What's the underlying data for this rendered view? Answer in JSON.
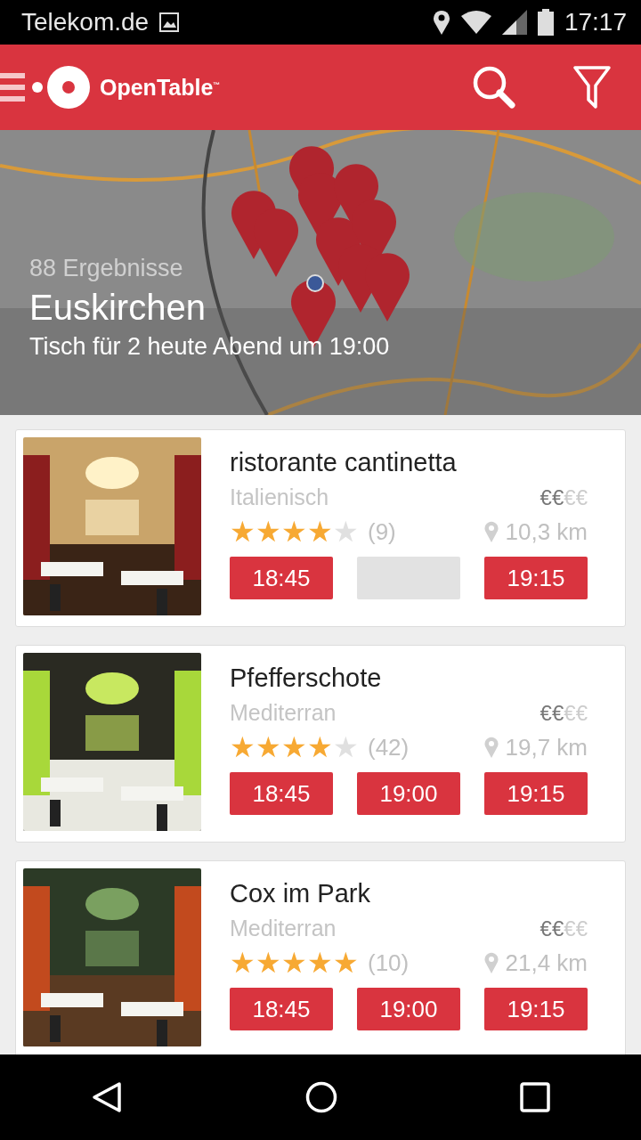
{
  "status_bar": {
    "carrier": "Telekom.de",
    "time": "17:17"
  },
  "app_bar": {
    "logo": "OpenTable$^{™}$"
  },
  "map": {
    "results": "88 Ergebnisse",
    "location": "Euskirchen",
    "query": "Tisch für 2 heute Abend um 19:00"
  },
  "restaurants": [
    {
      "name": "ristorante cantinetta",
      "cuisine": "Italienisch",
      "price": {
        "active": "€€",
        "inactive": "€€"
      },
      "stars": 4,
      "reviews": "(9)",
      "distance": "10,3 km",
      "slots": [
        {
          "time": "18:45",
          "available": true
        },
        {
          "available": false
        },
        {
          "time": "19:15",
          "available": true
        }
      ]
    },
    {
      "name": "Pfefferschote",
      "cuisine": "Mediterran",
      "price": {
        "active": "€€",
        "inactive": "€€"
      },
      "stars": 4,
      "reviews": "(42)",
      "distance": "19,7 km",
      "slots": [
        {
          "time": "18:45",
          "available": true
        },
        {
          "time": "19:00",
          "available": true
        },
        {
          "time": "19:15",
          "available": true
        }
      ]
    },
    {
      "name": "Cox im Park",
      "cuisine": "Mediterran",
      "price": {
        "active": "€€",
        "inactive": "€€"
      },
      "stars": 5,
      "reviews": "(10)",
      "distance": "21,4 km",
      "slots": [
        {
          "time": "18:45",
          "available": true
        },
        {
          "time": "19:00",
          "available": true
        },
        {
          "time": "19:15",
          "available": true
        }
      ]
    }
  ]
}
